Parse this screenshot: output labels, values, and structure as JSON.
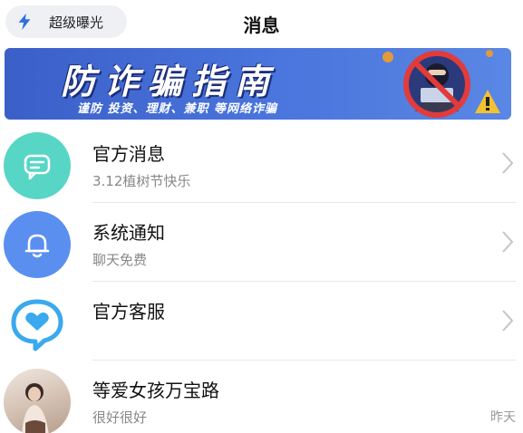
{
  "header": {
    "boost_label": "超级曝光",
    "title": "消息"
  },
  "banner": {
    "headline": "防诈骗指南",
    "subline": "谨防 投资、理财、兼职 等网络诈骗"
  },
  "messages": [
    {
      "title": "官方消息",
      "subtitle": "3.12植树节快乐",
      "time": "",
      "icon": "chat-bubble-icon",
      "color": "#57d6c5"
    },
    {
      "title": "系统通知",
      "subtitle": "聊天免费",
      "time": "",
      "icon": "bell-icon",
      "color": "#5b8fef"
    },
    {
      "title": "官方客服",
      "subtitle": "",
      "time": "",
      "icon": "heart-bubble-icon",
      "color": "#3aa9ee"
    },
    {
      "title": "等爱女孩万宝路",
      "subtitle": "很好很好",
      "time": "昨天",
      "icon": "user-avatar"
    }
  ],
  "colors": {
    "accent_blue": "#4a76dd",
    "official_teal": "#57d6c5",
    "system_blue": "#5b8fef"
  }
}
